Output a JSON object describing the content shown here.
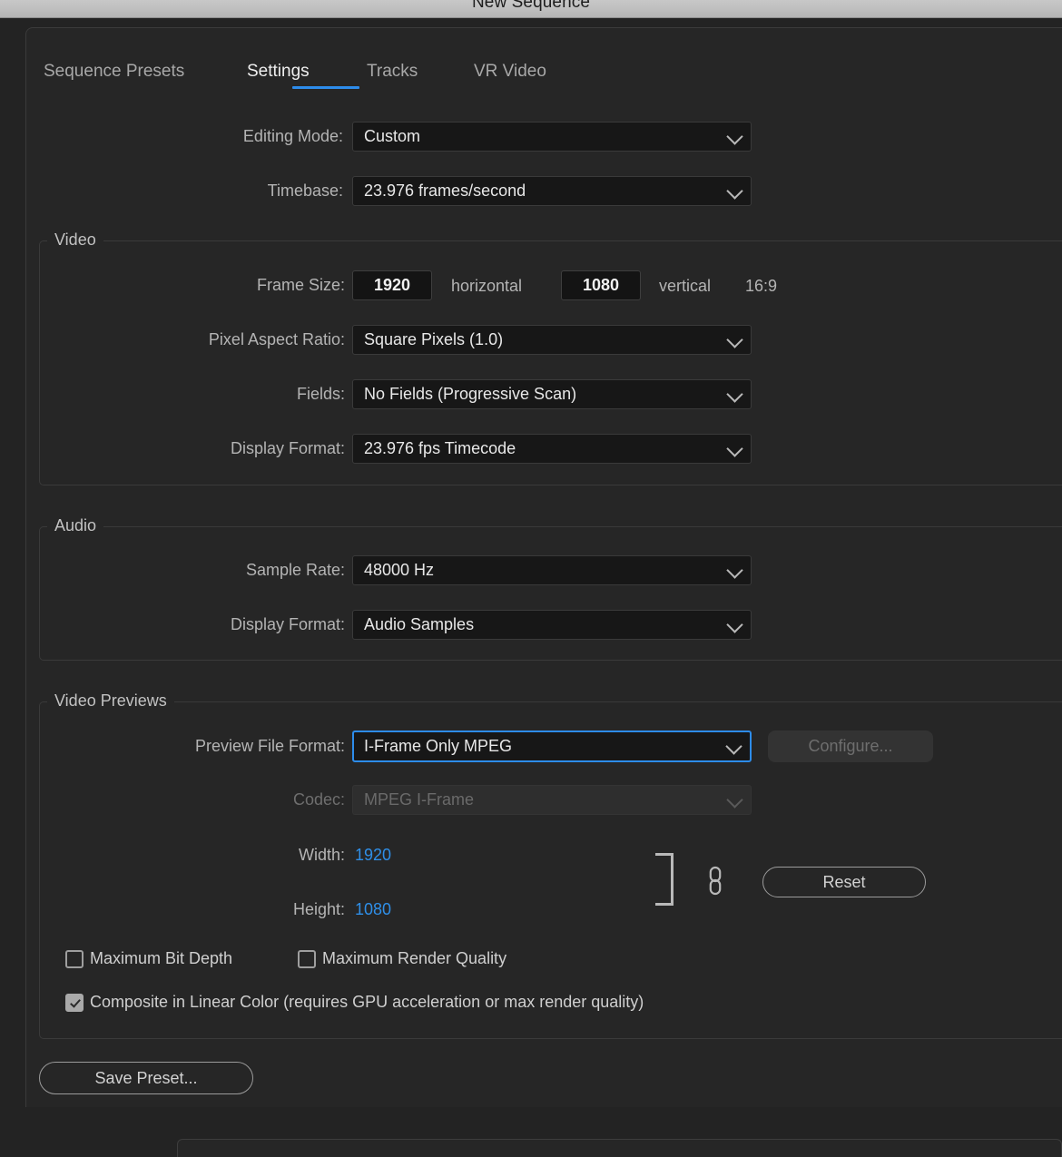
{
  "window": {
    "title": "New Sequence"
  },
  "tabs": [
    {
      "label": "Sequence Presets",
      "active": false
    },
    {
      "label": "Settings",
      "active": true
    },
    {
      "label": "Tracks",
      "active": false
    },
    {
      "label": "VR Video",
      "active": false
    }
  ],
  "top_fields": {
    "editing_mode_label": "Editing Mode:",
    "editing_mode_value": "Custom",
    "timebase_label": "Timebase:",
    "timebase_value": "23.976  frames/second"
  },
  "video": {
    "legend": "Video",
    "frame_size_label": "Frame Size:",
    "frame_width": "1920",
    "horizontal_label": "horizontal",
    "frame_height": "1080",
    "vertical_label": "vertical",
    "aspect_ratio": "16:9",
    "pixel_aspect_label": "Pixel Aspect Ratio:",
    "pixel_aspect_value": "Square Pixels (1.0)",
    "fields_label": "Fields:",
    "fields_value": "No Fields (Progressive Scan)",
    "display_format_label": "Display Format:",
    "display_format_value": "23.976 fps Timecode"
  },
  "audio": {
    "legend": "Audio",
    "sample_rate_label": "Sample Rate:",
    "sample_rate_value": "48000 Hz",
    "display_format_label": "Display Format:",
    "display_format_value": "Audio Samples"
  },
  "video_previews": {
    "legend": "Video Previews",
    "preview_format_label": "Preview File Format:",
    "preview_format_value": "I-Frame Only MPEG",
    "configure_label": "Configure...",
    "codec_label": "Codec:",
    "codec_value": "MPEG I-Frame",
    "width_label": "Width:",
    "width_value": "1920",
    "height_label": "Height:",
    "height_value": "1080",
    "reset_label": "Reset",
    "link_icon": "link-icon",
    "checkboxes": [
      {
        "label": "Maximum Bit Depth",
        "checked": false
      },
      {
        "label": "Maximum Render Quality",
        "checked": false
      },
      {
        "label": "Composite in Linear Color (requires GPU acceleration or max render quality)",
        "checked": true
      }
    ]
  },
  "footer": {
    "save_preset_label": "Save Preset..."
  },
  "colors": {
    "accent_blue": "#2d8ceb",
    "scrub_blue": "#2f8fe8",
    "panel_bg": "#262626",
    "field_bg": "#171717",
    "titlebar_bg": "#bdbdbd"
  }
}
